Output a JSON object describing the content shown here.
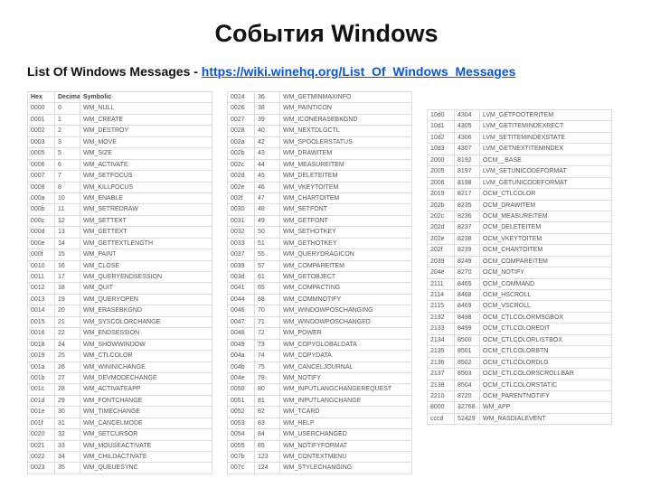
{
  "title": "События Windows",
  "subtitle_prefix": "List Of Windows Messages - ",
  "subtitle_link_text": "https://wiki.winehq.org/List_Of_Windows_Messages",
  "subtitle_link_href": "https://wiki.winehq.org/List_Of_Windows_Messages",
  "headers": {
    "hex": "Hex",
    "decimal": "Decimal",
    "symbolic": "Symbolic"
  },
  "col1": [
    {
      "hex": "0000",
      "dec": "0",
      "sym": "WM_NULL"
    },
    {
      "hex": "0001",
      "dec": "1",
      "sym": "WM_CREATE"
    },
    {
      "hex": "0002",
      "dec": "2",
      "sym": "WM_DESTROY"
    },
    {
      "hex": "0003",
      "dec": "3",
      "sym": "WM_MOVE"
    },
    {
      "hex": "0005",
      "dec": "5",
      "sym": "WM_SIZE"
    },
    {
      "hex": "0006",
      "dec": "6",
      "sym": "WM_ACTIVATE"
    },
    {
      "hex": "0007",
      "dec": "7",
      "sym": "WM_SETFOCUS"
    },
    {
      "hex": "0008",
      "dec": "8",
      "sym": "WM_KILLFOCUS"
    },
    {
      "hex": "000a",
      "dec": "10",
      "sym": "WM_ENABLE"
    },
    {
      "hex": "000b",
      "dec": "11",
      "sym": "WM_SETREDRAW"
    },
    {
      "hex": "000c",
      "dec": "12",
      "sym": "WM_SETTEXT"
    },
    {
      "hex": "000d",
      "dec": "13",
      "sym": "WM_GETTEXT"
    },
    {
      "hex": "000e",
      "dec": "14",
      "sym": "WM_GETTEXTLENGTH"
    },
    {
      "hex": "000f",
      "dec": "15",
      "sym": "WM_PAINT"
    },
    {
      "hex": "0010",
      "dec": "16",
      "sym": "WM_CLOSE"
    },
    {
      "hex": "0011",
      "dec": "17",
      "sym": "WM_QUERYENDSESSION"
    },
    {
      "hex": "0012",
      "dec": "18",
      "sym": "WM_QUIT"
    },
    {
      "hex": "0013",
      "dec": "19",
      "sym": "WM_QUERYOPEN"
    },
    {
      "hex": "0014",
      "dec": "20",
      "sym": "WM_ERASEBKGND"
    },
    {
      "hex": "0015",
      "dec": "21",
      "sym": "WM_SYSCOLORCHANGE"
    },
    {
      "hex": "0016",
      "dec": "22",
      "sym": "WM_ENDSESSION"
    },
    {
      "hex": "0018",
      "dec": "24",
      "sym": "WM_SHOWWINDOW"
    },
    {
      "hex": "0019",
      "dec": "25",
      "sym": "WM_CTLCOLOR"
    },
    {
      "hex": "001a",
      "dec": "26",
      "sym": "WM_WININICHANGE"
    },
    {
      "hex": "001b",
      "dec": "27",
      "sym": "WM_DEVMODECHANGE"
    },
    {
      "hex": "001c",
      "dec": "28",
      "sym": "WM_ACTIVATEAPP"
    },
    {
      "hex": "001d",
      "dec": "29",
      "sym": "WM_FONTCHANGE"
    },
    {
      "hex": "001e",
      "dec": "30",
      "sym": "WM_TIMECHANGE"
    },
    {
      "hex": "001f",
      "dec": "31",
      "sym": "WM_CANCELMODE"
    },
    {
      "hex": "0020",
      "dec": "32",
      "sym": "WM_SETCURSOR"
    },
    {
      "hex": "0021",
      "dec": "33",
      "sym": "WM_MOUSEACTIVATE"
    },
    {
      "hex": "0022",
      "dec": "34",
      "sym": "WM_CHILDACTIVATE"
    },
    {
      "hex": "0023",
      "dec": "35",
      "sym": "WM_QUEUESYNC"
    }
  ],
  "col2": [
    {
      "hex": "0024",
      "dec": "36",
      "sym": "WM_GETMINMAXINFO"
    },
    {
      "hex": "0026",
      "dec": "38",
      "sym": "WM_PAINTICON"
    },
    {
      "hex": "0027",
      "dec": "39",
      "sym": "WM_ICONERASEBKGND"
    },
    {
      "hex": "0028",
      "dec": "40",
      "sym": "WM_NEXTDLGCTL"
    },
    {
      "hex": "002a",
      "dec": "42",
      "sym": "WM_SPOOLERSTATUS"
    },
    {
      "hex": "002b",
      "dec": "43",
      "sym": "WM_DRAWITEM"
    },
    {
      "hex": "002c",
      "dec": "44",
      "sym": "WM_MEASUREITEM"
    },
    {
      "hex": "002d",
      "dec": "45",
      "sym": "WM_DELETEITEM"
    },
    {
      "hex": "002e",
      "dec": "46",
      "sym": "WM_VKEYTOITEM"
    },
    {
      "hex": "002f",
      "dec": "47",
      "sym": "WM_CHARTOITEM"
    },
    {
      "hex": "0030",
      "dec": "48",
      "sym": "WM_SETFONT"
    },
    {
      "hex": "0031",
      "dec": "49",
      "sym": "WM_GETFONT"
    },
    {
      "hex": "0032",
      "dec": "50",
      "sym": "WM_SETHOTKEY"
    },
    {
      "hex": "0033",
      "dec": "51",
      "sym": "WM_GETHOTKEY"
    },
    {
      "hex": "0037",
      "dec": "55",
      "sym": "WM_QUERYDRAGICON"
    },
    {
      "hex": "0039",
      "dec": "57",
      "sym": "WM_COMPAREITEM"
    },
    {
      "hex": "003d",
      "dec": "61",
      "sym": "WM_GETOBJECT"
    },
    {
      "hex": "0041",
      "dec": "65",
      "sym": "WM_COMPACTING"
    },
    {
      "hex": "0044",
      "dec": "68",
      "sym": "WM_COMMNOTIFY"
    },
    {
      "hex": "0046",
      "dec": "70",
      "sym": "WM_WINDOWPOSCHANGING"
    },
    {
      "hex": "0047",
      "dec": "71",
      "sym": "WM_WINDOWPOSCHANGED"
    },
    {
      "hex": "0048",
      "dec": "72",
      "sym": "WM_POWER"
    },
    {
      "hex": "0049",
      "dec": "73",
      "sym": "WM_COPYGLOBALDATA"
    },
    {
      "hex": "004a",
      "dec": "74",
      "sym": "WM_COPYDATA"
    },
    {
      "hex": "004b",
      "dec": "75",
      "sym": "WM_CANCELJOURNAL"
    },
    {
      "hex": "004e",
      "dec": "78",
      "sym": "WM_NOTIFY"
    },
    {
      "hex": "0050",
      "dec": "80",
      "sym": "WM_INPUTLANGCHANGEREQUEST"
    },
    {
      "hex": "0051",
      "dec": "81",
      "sym": "WM_INPUTLANGCHANGE"
    },
    {
      "hex": "0052",
      "dec": "82",
      "sym": "WM_TCARD"
    },
    {
      "hex": "0053",
      "dec": "83",
      "sym": "WM_HELP"
    },
    {
      "hex": "0054",
      "dec": "84",
      "sym": "WM_USERCHANGED"
    },
    {
      "hex": "0055",
      "dec": "85",
      "sym": "WM_NOTIFYFORMAT"
    },
    {
      "hex": "007b",
      "dec": "123",
      "sym": "WM_CONTEXTMENU"
    },
    {
      "hex": "007c",
      "dec": "124",
      "sym": "WM_STYLECHANGING"
    }
  ],
  "col3": [
    {
      "hex": "10d0",
      "dec": "4304",
      "sym": "LVM_GETFOOTERITEM"
    },
    {
      "hex": "10d1",
      "dec": "4305",
      "sym": "LVM_GETITEMINDEXRECT"
    },
    {
      "hex": "10d2",
      "dec": "4306",
      "sym": "LVM_SETITEMINDEXSTATE"
    },
    {
      "hex": "10d3",
      "dec": "4307",
      "sym": "LVM_GETNEXTITEMINDEX"
    },
    {
      "hex": "2000",
      "dec": "8192",
      "sym": "OCM__BASE"
    },
    {
      "hex": "2005",
      "dec": "8197",
      "sym": "LVM_SETUNICODEFORMAT"
    },
    {
      "hex": "2006",
      "dec": "8198",
      "sym": "LVM_GETUNICODEFORMAT"
    },
    {
      "hex": "2019",
      "dec": "8217",
      "sym": "OCM_CTLCOLOR"
    },
    {
      "hex": "202b",
      "dec": "8235",
      "sym": "OCM_DRAWITEM"
    },
    {
      "hex": "202c",
      "dec": "8236",
      "sym": "OCM_MEASUREITEM"
    },
    {
      "hex": "202d",
      "dec": "8237",
      "sym": "OCM_DELETEITEM"
    },
    {
      "hex": "202e",
      "dec": "8238",
      "sym": "OCM_VKEYTOITEM"
    },
    {
      "hex": "202f",
      "dec": "8239",
      "sym": "OCM_CHARTOITEM"
    },
    {
      "hex": "2039",
      "dec": "8249",
      "sym": "OCM_COMPAREITEM"
    },
    {
      "hex": "204e",
      "dec": "8270",
      "sym": "OCM_NOTIFY"
    },
    {
      "hex": "2111",
      "dec": "8465",
      "sym": "OCM_COMMAND"
    },
    {
      "hex": "2114",
      "dec": "8468",
      "sym": "OCM_HSCROLL"
    },
    {
      "hex": "2115",
      "dec": "8469",
      "sym": "OCM_VSCROLL"
    },
    {
      "hex": "2132",
      "dec": "8498",
      "sym": "OCM_CTLCOLORMSGBOX"
    },
    {
      "hex": "2133",
      "dec": "8499",
      "sym": "OCM_CTLCOLOREDIT"
    },
    {
      "hex": "2134",
      "dec": "8500",
      "sym": "OCM_CTLCOLORLISTBOX"
    },
    {
      "hex": "2135",
      "dec": "8501",
      "sym": "OCM_CTLCOLORBTN"
    },
    {
      "hex": "2136",
      "dec": "8502",
      "sym": "OCM_CTLCOLORDLG"
    },
    {
      "hex": "2137",
      "dec": "8503",
      "sym": "OCM_CTLCOLORSCROLLBAR"
    },
    {
      "hex": "2138",
      "dec": "8504",
      "sym": "OCM_CTLCOLORSTATIC"
    },
    {
      "hex": "2210",
      "dec": "8720",
      "sym": "OCM_PARENTNOTIFY"
    },
    {
      "hex": "8000",
      "dec": "32768",
      "sym": "WM_APP"
    },
    {
      "hex": "cccd",
      "dec": "52429",
      "sym": "WM_RASDIALEVENT"
    }
  ]
}
